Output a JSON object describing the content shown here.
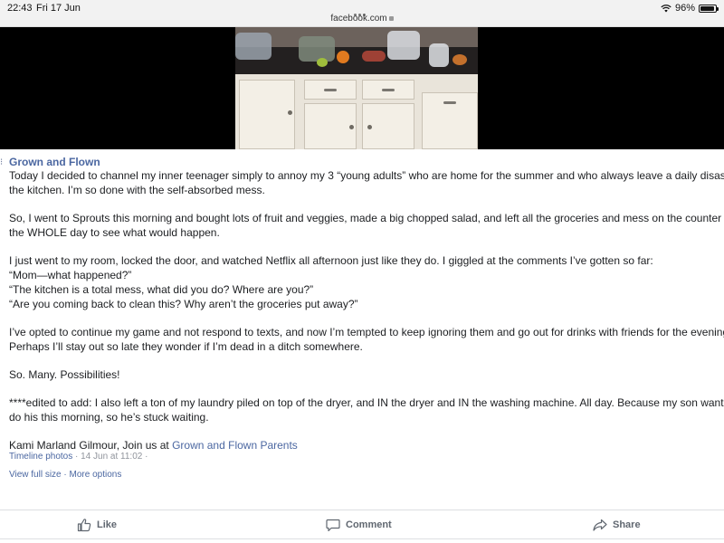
{
  "status_bar": {
    "time": "22:43",
    "date": "Fri 17 Jun",
    "url": "facebook.com",
    "battery": "96%",
    "battery_level": 0.96
  },
  "post": {
    "author": "Grown and Flown",
    "paragraphs": [
      [
        "Today I decided to channel my inner teenager simply to annoy my 3 “young adults” who are home for the summer and who always leave a daily disaster",
        "the kitchen. I’m so done with the self-absorbed mess."
      ],
      [
        "So, I went to Sprouts this morning and bought lots of fruit and veggies, made a big chopped salad, and left all the groceries and mess on the counter for",
        "the WHOLE day to see what would happen."
      ],
      [
        "I just went to my room, locked the door, and watched Netflix all afternoon just like they do. I giggled at the comments I’ve gotten so far:",
        "“Mom—what happened?”",
        "“The kitchen is a total mess, what did you do? Where are you?”",
        "“Are you coming back to clean this? Why aren’t the groceries put away?”"
      ],
      [
        "I’ve opted to continue my game and not respond to texts, and now I’m tempted to keep ignoring them and go out for drinks with friends for the evening.",
        "Perhaps I’ll stay out so late they wonder if I’m dead in a ditch somewhere."
      ],
      [
        "So. Many. Possibilities!"
      ],
      [
        "****edited to add: I also left a ton of my laundry piled on top of the dryer, and IN the dryer and IN the washing machine. All day. Because my son wanted",
        "do his this morning, so he’s stuck waiting."
      ]
    ],
    "credit_prefix": "Kami Marland Gilmour, Join us at ",
    "credit_link": "Grown and Flown Parents",
    "album": "Timeline photos",
    "timestamp": " · 14 Jun at 11:02 ·",
    "view_full_size": "View full size",
    "more_options": "More options",
    "separator": " · "
  },
  "actions": {
    "like": "Like",
    "comment": "Comment",
    "share": "Share"
  },
  "colors": {
    "link": "#4b67a1",
    "text": "#1c1e21",
    "muted": "#606770"
  },
  "icons": {
    "like": "thumbs-up-icon",
    "comment": "speech-bubble-icon",
    "share": "share-arrow-icon",
    "wifi": "wifi-icon",
    "battery": "battery-icon",
    "lock": "lock-icon"
  }
}
